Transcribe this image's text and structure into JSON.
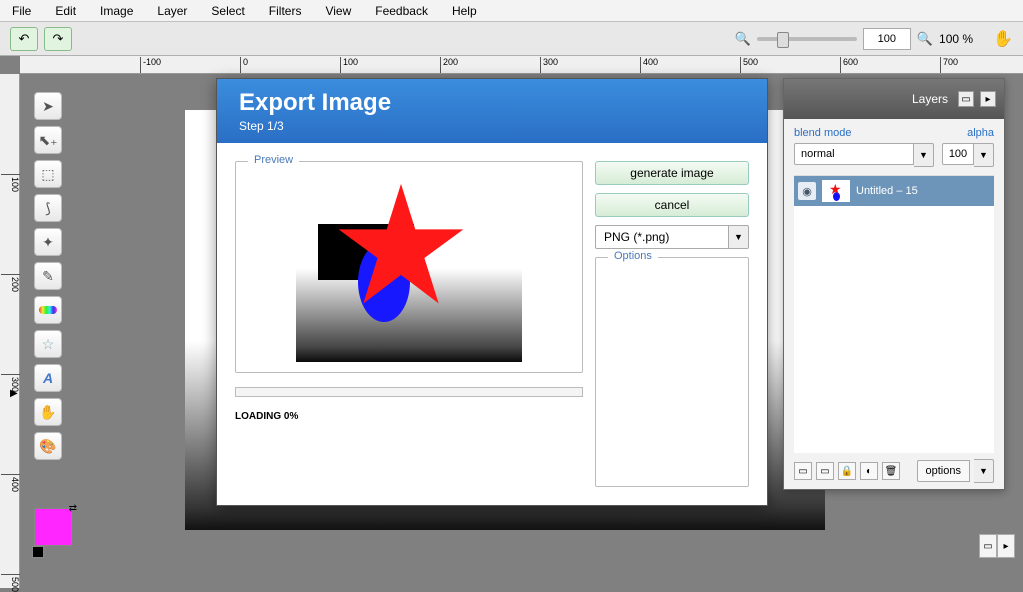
{
  "menu": {
    "items": [
      "File",
      "Edit",
      "Image",
      "Layer",
      "Select",
      "Filters",
      "View",
      "Feedback",
      "Help"
    ]
  },
  "toolbar": {
    "zoom_value": "100",
    "zoom_pct": "100 %"
  },
  "ruler_h": [
    -100,
    0,
    100,
    200,
    300,
    400,
    500,
    600,
    700
  ],
  "ruler_v": [
    100,
    200,
    300,
    400,
    500
  ],
  "dialog": {
    "title": "Export Image",
    "step": "Step 1/3",
    "preview_label": "Preview",
    "generate": "generate image",
    "cancel": "cancel",
    "format_selected": "PNG (*.png)",
    "options_label": "Options",
    "loading": "LOADING 0%"
  },
  "layers": {
    "title": "Layers",
    "blend_label": "blend mode",
    "alpha_label": "alpha",
    "blend_value": "normal",
    "alpha_value": "100",
    "item_name": "Untitled – 15",
    "options_btn": "options"
  },
  "swatch": {
    "fg": "#ff26ff",
    "bg": "#000000"
  }
}
